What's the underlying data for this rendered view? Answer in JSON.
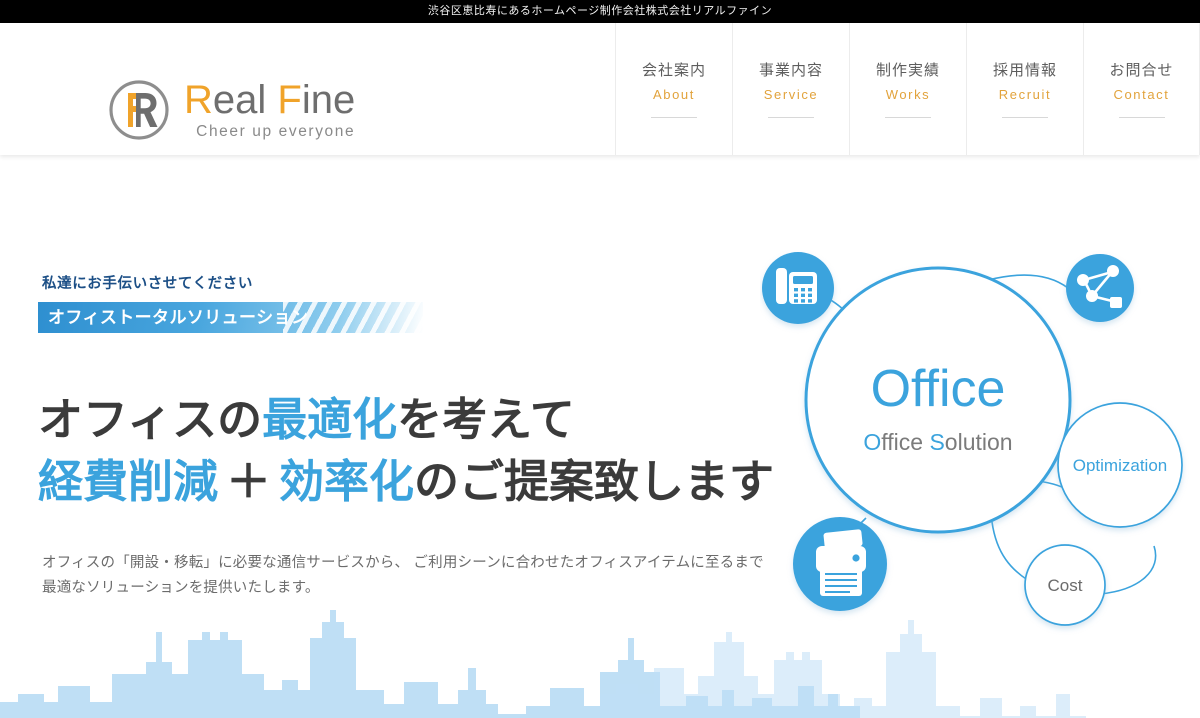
{
  "topbar": {
    "text": "渋谷区恵比寿にあるホームページ制作会社株式会社リアルファイン"
  },
  "header": {
    "logo": {
      "mark_icon": "real-fine-r-monogram",
      "name_part1": "R",
      "name_part2": "eal ",
      "name_part3": "F",
      "name_part4": "ine",
      "name_full": "Real Fine",
      "tagline": "Cheer up everyone",
      "accent_color": "#f0a32a",
      "text_color": "#6e6e6e"
    },
    "nav": [
      {
        "ja": "会社案内",
        "en": "About"
      },
      {
        "ja": "事業内容",
        "en": "Service"
      },
      {
        "ja": "制作実績",
        "en": "Works"
      },
      {
        "ja": "採用情報",
        "en": "Recruit"
      },
      {
        "ja": "お問合せ",
        "en": "Contact"
      }
    ],
    "nav_en_color": "#e2a33c"
  },
  "hero": {
    "lead": "私達にお手伝いさせてください",
    "ribbon": "オフィストータルソリューション",
    "headline": {
      "line1_a": "オフィスの",
      "line1_b": "最適化",
      "line1_c": "を考えて",
      "line2_a": "経費削減",
      "line2_plus": "＋",
      "line2_b": "効率化",
      "line2_c": "のご提案致します"
    },
    "description_line1": "オフィスの「開設・移転」に必要な通信サービスから、 ご利用シーンに合わせたオフィスアイテムに至るまで",
    "description_line2": "最適なソリューションを提供いたします。",
    "accent_blue": "#3ba3dd",
    "text_dark": "#3b3b3b"
  },
  "diagram": {
    "center_title": "Office",
    "center_subtitle_a": "O",
    "center_subtitle_b": "ffice ",
    "center_subtitle_c": "S",
    "center_subtitle_d": "olution",
    "center_subtitle_full": "Office Solution",
    "nodes": [
      {
        "label": "Optimization"
      },
      {
        "label": "Cost"
      }
    ],
    "icons": [
      {
        "name": "desk-phone-icon"
      },
      {
        "name": "network-icon"
      },
      {
        "name": "printer-icon"
      }
    ],
    "line_color": "#3ba3dd",
    "fill_color": "#3ba3dd"
  },
  "skyline": {
    "color": "#bfdff5"
  }
}
